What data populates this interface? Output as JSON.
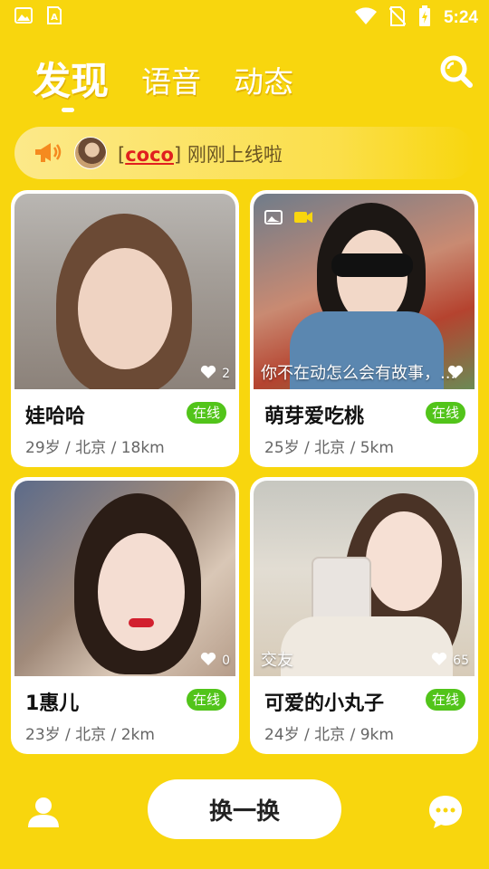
{
  "status_bar": {
    "time": "5:24",
    "left_icons": [
      "gallery-icon",
      "font-icon"
    ],
    "right_icons": [
      "wifi-icon",
      "no-sim-icon",
      "battery-charging-icon"
    ]
  },
  "tabs": [
    {
      "label": "发现",
      "active": true
    },
    {
      "label": "语音",
      "active": false
    },
    {
      "label": "动态",
      "active": false
    }
  ],
  "notice": {
    "bracket_open": "[",
    "username": "coco",
    "bracket_close": "]",
    "message": " 刚刚上线啦"
  },
  "cards": [
    {
      "name": "娃哈哈",
      "status": "在线",
      "info": "29岁 / 北京 / 18km",
      "likes": "2",
      "caption": ""
    },
    {
      "name": "萌芽爱吃桃",
      "status": "在线",
      "info": "25岁 / 北京 / 5km",
      "likes": "",
      "caption": "你不在动怎么会有故事，..."
    },
    {
      "name": "1惠儿",
      "status": "在线",
      "info": "23岁 / 北京 / 2km",
      "likes": "0",
      "caption": ""
    },
    {
      "name": "可爱的小丸子",
      "status": "在线",
      "info": "24岁 / 北京 / 9km",
      "likes": "65",
      "caption": "交友"
    }
  ],
  "bottom": {
    "refresh_label": "换一换"
  },
  "colors": {
    "background": "#F8D60E",
    "online_badge": "#52c41a",
    "username_highlight": "#e01f1f"
  }
}
